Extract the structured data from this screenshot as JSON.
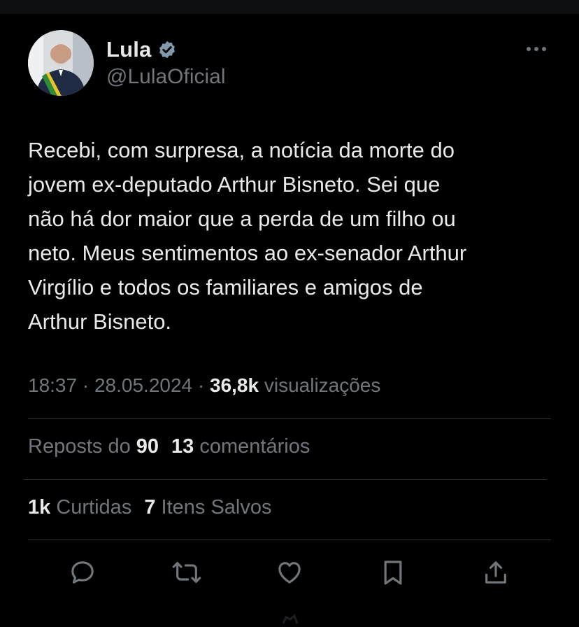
{
  "author": {
    "name": "Lula",
    "handle": "@LulaOficial",
    "verified_icon": "verified-badge-icon",
    "avatar_icon": "avatar"
  },
  "tweet": {
    "text": "Recebi, com surpresa, a notícia da morte do\njovem ex-deputado Arthur Bisneto. Sei que\nnão há dor maior que a perda de um filho ou\nneto. Meus sentimentos ao ex-senador Arthur\nVirgílio e todos os familiares e amigos de\nArthur Bisneto."
  },
  "meta": {
    "time": "18:37",
    "separator": "·",
    "date": "28.05.2024",
    "views_count": "36,8k",
    "views_label": "visualizações"
  },
  "stats_row1": {
    "reposts_label": "Reposts do",
    "reposts_count": "90",
    "comments_count": "13",
    "comments_label": "comentários"
  },
  "stats_row2": {
    "likes_count": "1k",
    "likes_label": "Curtidas",
    "saves_count": "7",
    "saves_label": "Itens Salvos"
  },
  "actions": [
    "reply-icon",
    "repost-icon",
    "like-icon",
    "bookmark-icon",
    "share-icon"
  ],
  "colors": {
    "background": "#000000",
    "text": "#e7e9ea",
    "muted": "#71767b",
    "divider": "#2f3336",
    "verified": "#829aab"
  }
}
